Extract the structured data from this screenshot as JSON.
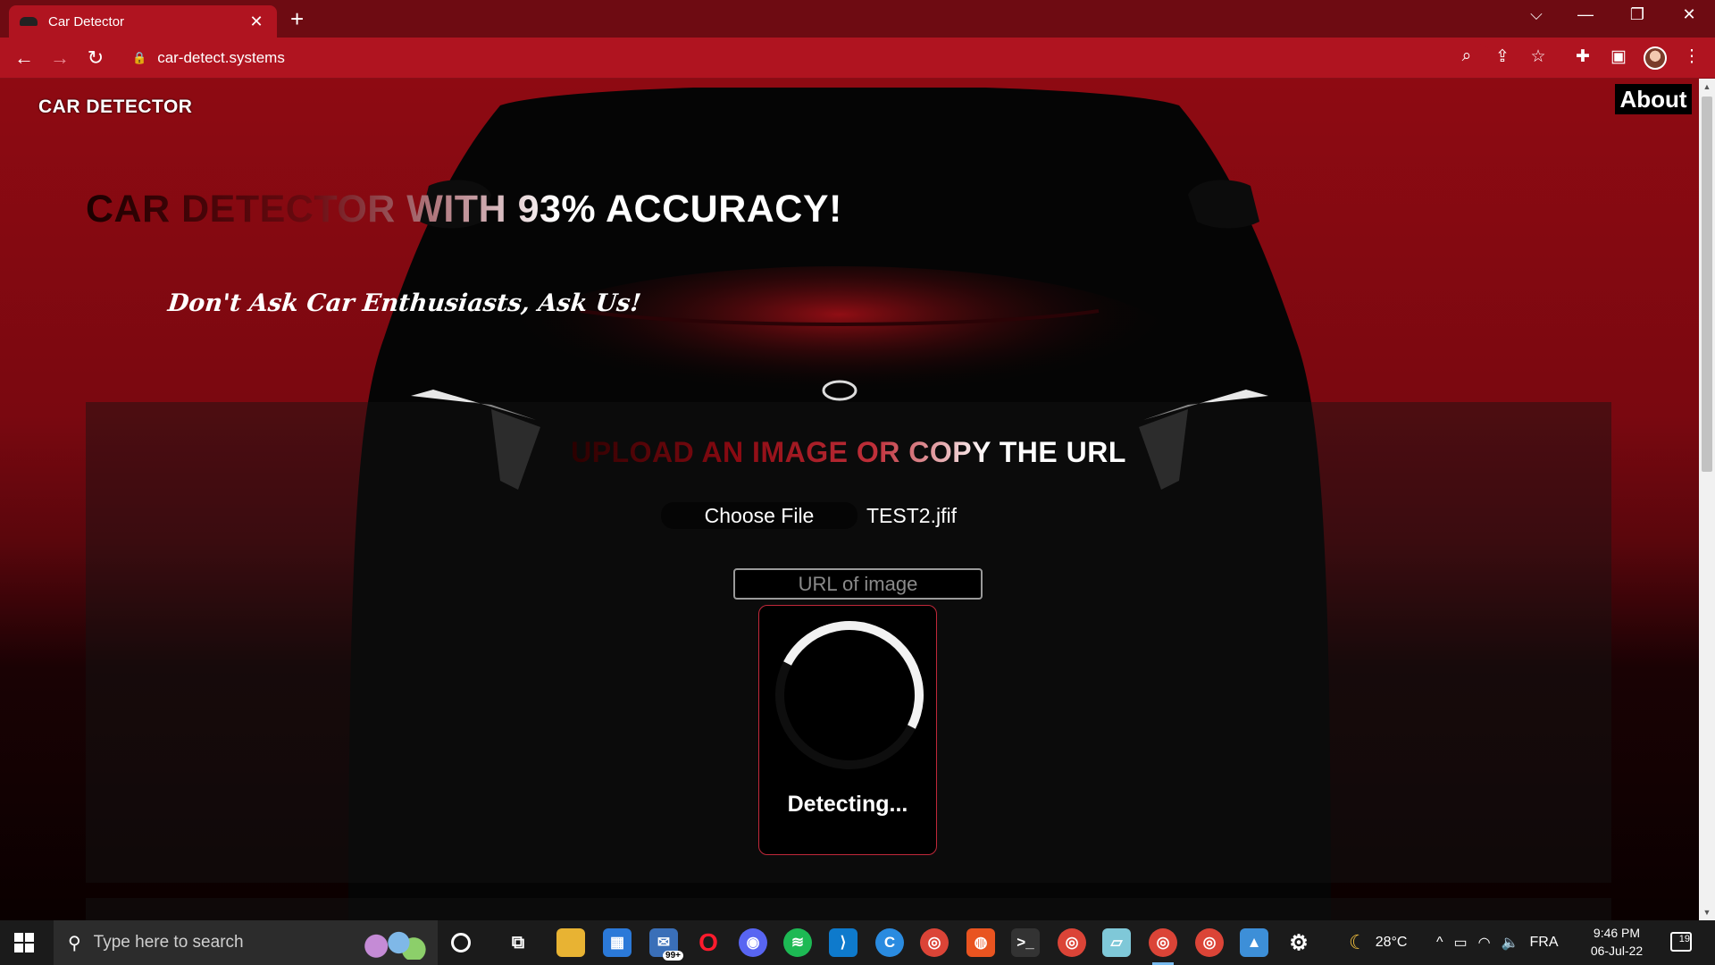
{
  "browser": {
    "tab_title": "Car Detector",
    "tab_close": "✕",
    "new_tab": "+",
    "url": "car-detect.systems",
    "window_controls": {
      "dropdown": "⌵",
      "minimize": "—",
      "restore": "❐",
      "close": "✕"
    }
  },
  "site": {
    "brand": "CAR DETECTOR",
    "nav_about": "About",
    "hero_title": "CAR DETECTOR WITH 93% ACCURACY!",
    "tagline": "Don't Ask Car Enthusiasts, Ask Us!",
    "panel_heading": "UPLOAD AN IMAGE OR COPY THE URL",
    "choose_file_label": "Choose File",
    "selected_file": "TEST2.jfif",
    "url_placeholder": "URL of image",
    "status": "Detecting..."
  },
  "taskbar": {
    "search_placeholder": "Type here to search",
    "mail_badge": "99+",
    "weather": "28°C",
    "language": "FRA",
    "time": "9:46 PM",
    "date": "06-Jul-22",
    "notification_count": "19"
  },
  "colors": {
    "chrome_bg": "#b01420",
    "tabstrip_bg": "#6e0b12",
    "page_red": "#8e0a12",
    "detect_border": "#c0283a"
  }
}
